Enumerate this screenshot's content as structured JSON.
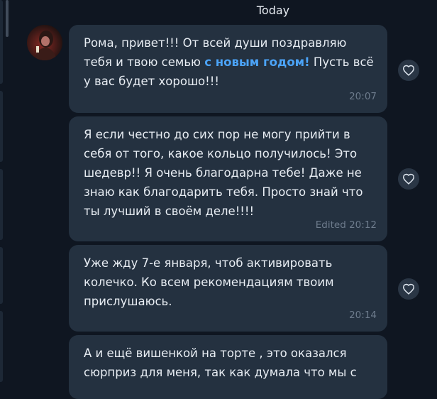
{
  "date_separator": "Today",
  "messages": [
    {
      "text_before": "Рома, привет!!! От всей души поздравляю тебя и твою семью ",
      "highlight": "с новым годом!",
      "text_after": " Пусть всё у вас будет хорошо!!!",
      "time": "20:07"
    },
    {
      "text": "Я если честно до сих пор не могу прийти в себя от того, какое кольцо получилось! Это шедевр!!  Я очень благодарна тебе! Даже не знаю как благодарить тебя. Просто знай что ты лучший в своём деле!!!!",
      "time": "Edited 20:12"
    },
    {
      "text": "Уже жду 7-е января, чтоб активировать колечко. Ко всем рекомендациям твоим прислушаюсь.",
      "time": "20:14"
    },
    {
      "text": "А и ещё вишенкой на торте , это оказался сюрприз для меня, так как думала что мы с"
    }
  ],
  "icons": {
    "reaction": "heart-icon",
    "avatar": "user-avatar"
  },
  "colors": {
    "background": "#0f1621",
    "bubble": "#243140",
    "text": "#e8edf3",
    "highlight": "#4ba3f7",
    "timestamp": "#6d7b8c"
  }
}
